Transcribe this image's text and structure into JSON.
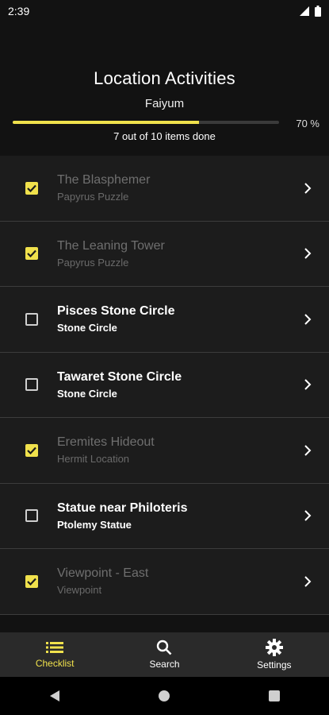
{
  "status_bar": {
    "time": "2:39"
  },
  "header": {
    "title": "Location Activities",
    "location": "Faiyum",
    "progress_percent_label": "70 %",
    "progress_value": 0.7,
    "progress_text": "7 out of 10 items done"
  },
  "items": [
    {
      "name": "The Blasphemer",
      "type": "Papyrus Puzzle",
      "checked": true
    },
    {
      "name": "The Leaning Tower",
      "type": "Papyrus Puzzle",
      "checked": true
    },
    {
      "name": "Pisces Stone Circle",
      "type": "Stone Circle",
      "checked": false
    },
    {
      "name": "Tawaret Stone Circle",
      "type": "Stone Circle",
      "checked": false
    },
    {
      "name": "Eremites Hideout",
      "type": "Hermit Location",
      "checked": true
    },
    {
      "name": "Statue near Philoteris",
      "type": "Ptolemy Statue",
      "checked": false
    },
    {
      "name": "Viewpoint - East",
      "type": "Viewpoint",
      "checked": true
    }
  ],
  "bottom_nav": {
    "checklist": "Checklist",
    "search": "Search",
    "settings": "Settings"
  },
  "colors": {
    "accent": "#f0e14c",
    "background": "#121212",
    "row": "#1c1c1c"
  }
}
